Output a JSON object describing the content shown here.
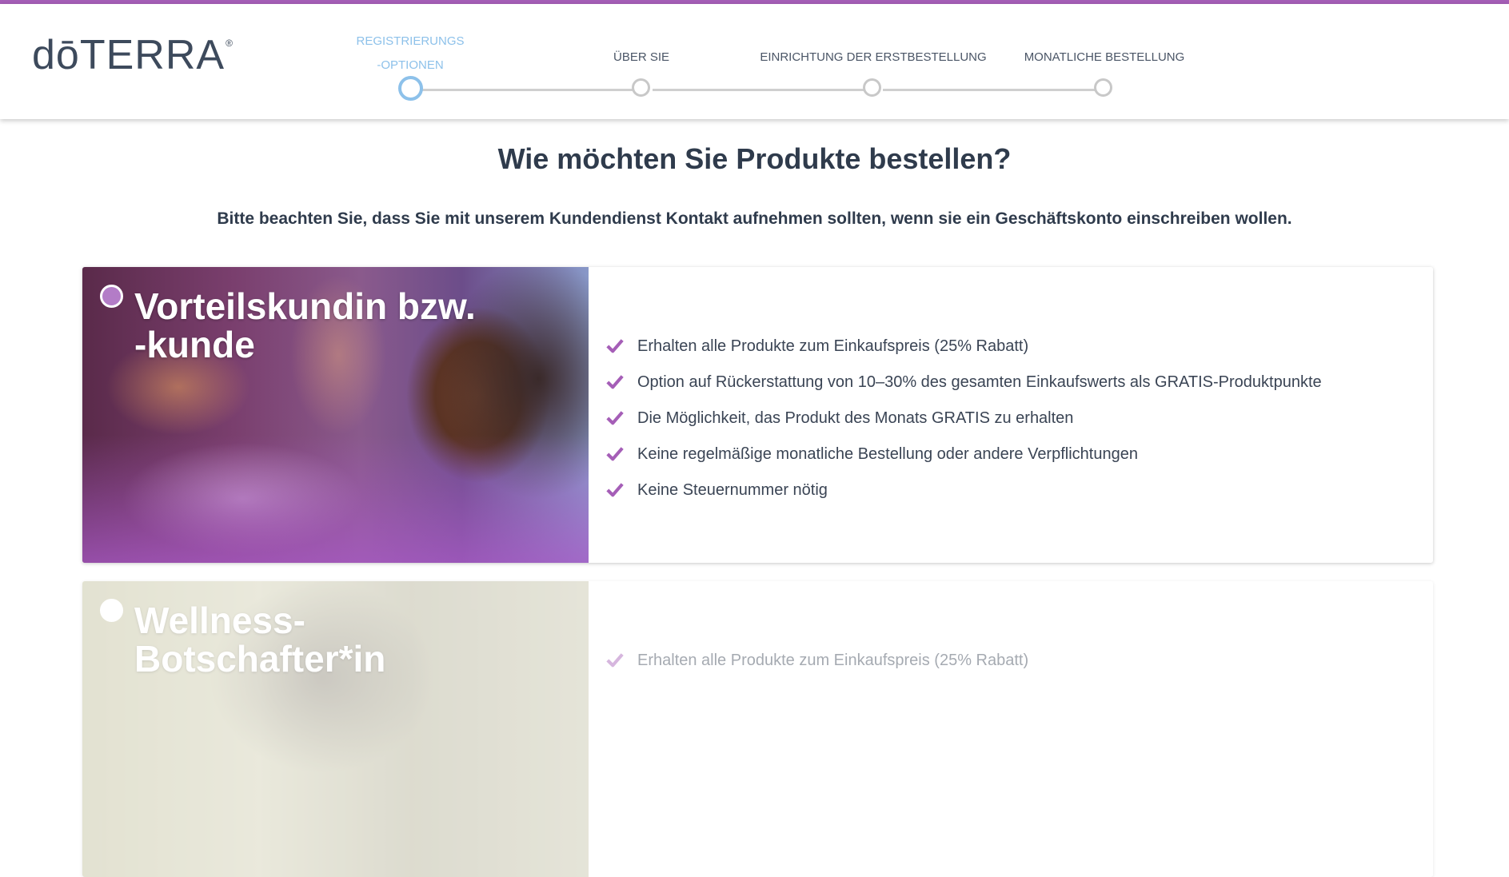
{
  "brand": {
    "logo_text": "dōTERRA",
    "logo_reg": "®",
    "accent": "#a55eb7"
  },
  "steps": [
    {
      "label_line1": "REGISTRIERUNGS",
      "label_line2": "-OPTIONEN",
      "active": true
    },
    {
      "label_line1": "ÜBER SIE",
      "label_line2": "",
      "active": false
    },
    {
      "label_line1": "EINRICHTUNG DER ERSTBESTELLUNG",
      "label_line2": "",
      "active": false
    },
    {
      "label_line1": "MONATLICHE BESTELLUNG",
      "label_line2": "",
      "active": false
    }
  ],
  "page": {
    "title": "Wie möchten Sie Produkte bestellen?",
    "subtitle": "Bitte beachten Sie, dass Sie mit unserem Kundendienst Kontakt aufnehmen sollten, wenn sie ein Geschäftskonto einschreiben wollen."
  },
  "options": [
    {
      "title_line1": "Vorteilskundin bzw.",
      "title_line2": "-kunde",
      "selected": true,
      "benefits": [
        "Erhalten alle Produkte zum Einkaufspreis (25% Rabatt)",
        "Option auf Rückerstattung von 10–30% des gesamten Einkaufswerts als GRATIS-Produktpunkte",
        "Die Möglichkeit, das Produkt des Monats GRATIS zu erhalten",
        "Keine regelmäßige monatliche Bestellung oder andere Verpflichtungen",
        "Keine Steuernummer nötig"
      ]
    },
    {
      "title_line1": "Wellness-",
      "title_line2": "Botschafter*in",
      "selected": false,
      "benefits": [
        "Erhalten alle Produkte zum Einkaufspreis (25% Rabatt)"
      ]
    }
  ],
  "icons": {
    "check": "check-icon",
    "radio": "radio-icon"
  }
}
